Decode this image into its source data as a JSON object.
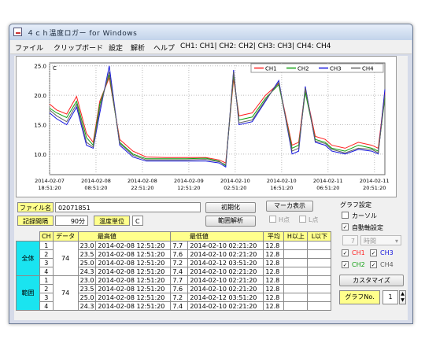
{
  "window": {
    "title": "４ｃｈ温度ロガー for Windows"
  },
  "menu": {
    "file": "ファイル",
    "clipboard": "クリップボード",
    "settings": "設定",
    "analysis": "解析",
    "help": "ヘルプ",
    "channels": "CH1: CH1| CH2: CH2| CH3: CH3| CH4: CH4"
  },
  "chart_data": {
    "type": "line",
    "ylabel": "C",
    "ylim": [
      6.5,
      25.5
    ],
    "yticks": [
      "25.0",
      "20.0",
      "15.0",
      "10.0"
    ],
    "x": [
      "2014-02-07 18:51:20",
      "2014-02-07 21:00",
      "2014-02-08 00:00",
      "2014-02-08 03:00",
      "2014-02-08 06:00",
      "2014-02-08 08:00",
      "2014-02-08 10:00",
      "2014-02-08 12:51:20",
      "2014-02-08 16:00",
      "2014-02-08 20:00",
      "2014-02-09 00:00",
      "2014-02-09 06:00",
      "2014-02-09 12:00",
      "2014-02-09 18:00",
      "2014-02-09 22:00",
      "2014-02-10 00:00",
      "2014-02-10 02:21:20",
      "2014-02-10 04:00",
      "2014-02-10 08:00",
      "2014-02-10 12:00",
      "2014-02-10 16:00",
      "2014-02-10 20:00",
      "2014-02-10 22:00",
      "2014-02-11 00:00",
      "2014-02-11 03:00",
      "2014-02-11 06:00",
      "2014-02-11 08:00",
      "2014-02-11 12:00",
      "2014-02-11 16:00",
      "2014-02-11 20:00",
      "2014-02-11 22:00",
      "2014-02-12 00:00"
    ],
    "xticks": [
      {
        "date": "2014-02-07",
        "time": "18:51:20"
      },
      {
        "date": "2014-02-08",
        "time": "08:51:20"
      },
      {
        "date": "2014-02-08",
        "time": "22:51:20"
      },
      {
        "date": "2014-02-09",
        "time": "12:51:20"
      },
      {
        "date": "2014-02-10",
        "time": "02:51:20"
      },
      {
        "date": "2014-02-10",
        "time": "16:51:20"
      },
      {
        "date": "2014-02-11",
        "time": "06:51:20"
      },
      {
        "date": "2014-02-11",
        "time": "20:51:20"
      }
    ],
    "grid": true,
    "legend": "top-right",
    "series": [
      {
        "name": "CH1",
        "color": "#ff2020",
        "values": [
          18.5,
          17.5,
          16.8,
          19.8,
          13.5,
          12.0,
          19.0,
          23.0,
          12.5,
          10.5,
          9.5,
          9.4,
          9.4,
          9.4,
          9.0,
          8.5,
          22.8,
          16.5,
          17.0,
          20.0,
          22.0,
          11.5,
          12.0,
          21.0,
          13.0,
          12.5,
          11.5,
          11.0,
          12.0,
          11.5,
          11.0,
          20.5
        ]
      },
      {
        "name": "CH2",
        "color": "#10a010",
        "values": [
          17.8,
          17.0,
          16.2,
          19.0,
          12.8,
          11.5,
          18.5,
          23.5,
          12.0,
          10.0,
          9.2,
          9.2,
          9.2,
          9.3,
          8.8,
          8.0,
          23.5,
          15.8,
          16.3,
          19.5,
          21.8,
          11.0,
          11.5,
          20.5,
          12.5,
          12.0,
          11.0,
          10.5,
          11.5,
          11.0,
          10.5,
          19.5
        ]
      },
      {
        "name": "CH3",
        "color": "#1515dd",
        "values": [
          17.0,
          16.0,
          15.0,
          18.0,
          11.5,
          11.0,
          17.0,
          25.0,
          11.5,
          9.5,
          8.8,
          8.8,
          8.8,
          8.8,
          8.5,
          7.8,
          24.3,
          15.0,
          15.5,
          19.0,
          22.5,
          10.0,
          10.5,
          21.5,
          12.0,
          11.5,
          10.5,
          10.0,
          10.8,
          10.5,
          10.0,
          21.0
        ]
      },
      {
        "name": "CH4",
        "color": "#606060",
        "values": [
          17.5,
          16.5,
          15.5,
          18.5,
          12.0,
          11.2,
          17.8,
          24.0,
          11.8,
          9.8,
          9.0,
          9.0,
          9.0,
          9.1,
          8.7,
          8.2,
          24.0,
          15.3,
          15.8,
          19.2,
          22.2,
          10.5,
          11.0,
          21.2,
          12.2,
          11.8,
          10.8,
          10.2,
          11.0,
          10.8,
          10.2,
          20.0
        ]
      }
    ]
  },
  "info": {
    "file_label": "ファイル名",
    "file_value": "02071851",
    "interval_label": "記録間隔",
    "interval_value": "90分",
    "unit_label": "温度単位",
    "unit_value": "C"
  },
  "buttons": {
    "init": "初期化",
    "marker": "マーカ表示",
    "range": "範囲解析",
    "customize": "カスタマイズ",
    "graph_no": "グラフNo.",
    "graph_no_value": "1"
  },
  "marks": {
    "h": "H点",
    "l": "L点"
  },
  "graph_settings": {
    "title": "グラフ設定",
    "cursor": "カーソル",
    "auto_scale": "自動軸設定",
    "hours_value": "7",
    "hours_unit": "時間",
    "ch1": "CH1",
    "ch3": "CH3",
    "ch2": "CH2",
    "ch4": "CH4"
  },
  "table": {
    "headers": {
      "ch": "CH",
      "data": "データ",
      "max": "最高値",
      "min": "最低値",
      "avg": "平均",
      "above": "H以上",
      "below": "L以下"
    },
    "groups": [
      {
        "label": "全体",
        "count": "74",
        "rows": [
          {
            "ch": "1",
            "max": "23.0",
            "max_t": "2014-02-08 12:51:20",
            "min": "7.7",
            "min_t": "2014-02-10 02:21:20",
            "avg": "12.8"
          },
          {
            "ch": "2",
            "max": "23.5",
            "max_t": "2014-02-08 12:51:20",
            "min": "7.6",
            "min_t": "2014-02-10 02:21:20",
            "avg": "12.8"
          },
          {
            "ch": "3",
            "max": "25.0",
            "max_t": "2014-02-08 12:51:20",
            "min": "7.2",
            "min_t": "2014-02-12 03:51:20",
            "avg": "12.8"
          },
          {
            "ch": "4",
            "max": "24.3",
            "max_t": "2014-02-08 12:51:20",
            "min": "7.4",
            "min_t": "2014-02-10 02:21:20",
            "avg": "12.8"
          }
        ]
      },
      {
        "label": "範囲",
        "count": "74",
        "rows": [
          {
            "ch": "1",
            "max": "23.0",
            "max_t": "2014-02-08 12:51:20",
            "min": "7.7",
            "min_t": "2014-02-10 02:21:20",
            "avg": "12.8"
          },
          {
            "ch": "2",
            "max": "23.5",
            "max_t": "2014-02-08 12:51:20",
            "min": "7.6",
            "min_t": "2014-02-10 02:21:20",
            "avg": "12.8"
          },
          {
            "ch": "3",
            "max": "25.0",
            "max_t": "2014-02-08 12:51:20",
            "min": "7.2",
            "min_t": "2014-02-12 03:51:20",
            "avg": "12.8"
          },
          {
            "ch": "4",
            "max": "24.3",
            "max_t": "2014-02-08 12:51:20",
            "min": "7.4",
            "min_t": "2014-02-10 02:21:20",
            "avg": "12.8"
          }
        ]
      }
    ]
  }
}
